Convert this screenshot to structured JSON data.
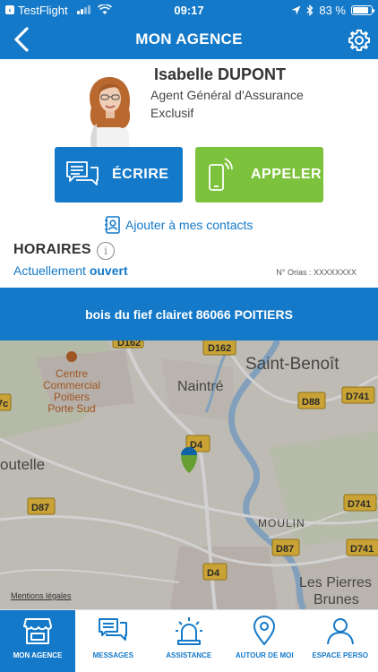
{
  "status_bar": {
    "back_app": "TestFlight",
    "time": "09:17",
    "battery": "83 %",
    "battery_level": 0.83
  },
  "header": {
    "title": "MON AGENCE"
  },
  "agent": {
    "name": "Isabelle DUPONT",
    "role": "Agent Général d'Assurance Exclusif"
  },
  "actions": {
    "write": "ÉCRIRE",
    "call": "APPELER",
    "add_contacts": "Ajouter à mes contacts"
  },
  "hours": {
    "title": "HORAIRES",
    "status_prefix": "Actuellement",
    "status_value": "ouvert",
    "orias": "N° Orias : XXXXXXXX"
  },
  "address": "bois du fief clairet 86066 POITIERS",
  "map": {
    "labels": {
      "saint_benoit": "Saint-Benoît",
      "naintre": "Naintré",
      "centre_commercial": "Centre",
      "centre_commercial_2": "Commercial",
      "centre_commercial_3": "Poitiers",
      "centre_commercial_4": "Porte Sud",
      "outelle": "outelle",
      "moulin": "MOULIN",
      "les_pierres": "Les Pierres",
      "brunes": "Brunes"
    },
    "roads": [
      "D162",
      "D162",
      "D88",
      "D741",
      "D4",
      "D87",
      "D741",
      "D87",
      "D4",
      "D741",
      "7c"
    ],
    "legal": "Mentions légales"
  },
  "tabs": [
    {
      "label": "MON AGENCE",
      "icon": "shop-icon",
      "active": true
    },
    {
      "label": "MESSAGES",
      "icon": "messages-icon",
      "active": false
    },
    {
      "label": "ASSISTANCE",
      "icon": "siren-icon",
      "active": false
    },
    {
      "label": "AUTOUR DE MOI",
      "icon": "location-pin-icon",
      "active": false
    },
    {
      "label": "ESPACE PERSO",
      "icon": "user-icon",
      "active": false
    }
  ],
  "colors": {
    "brand_blue": "#1479c8",
    "call_green": "#7dc23c"
  }
}
